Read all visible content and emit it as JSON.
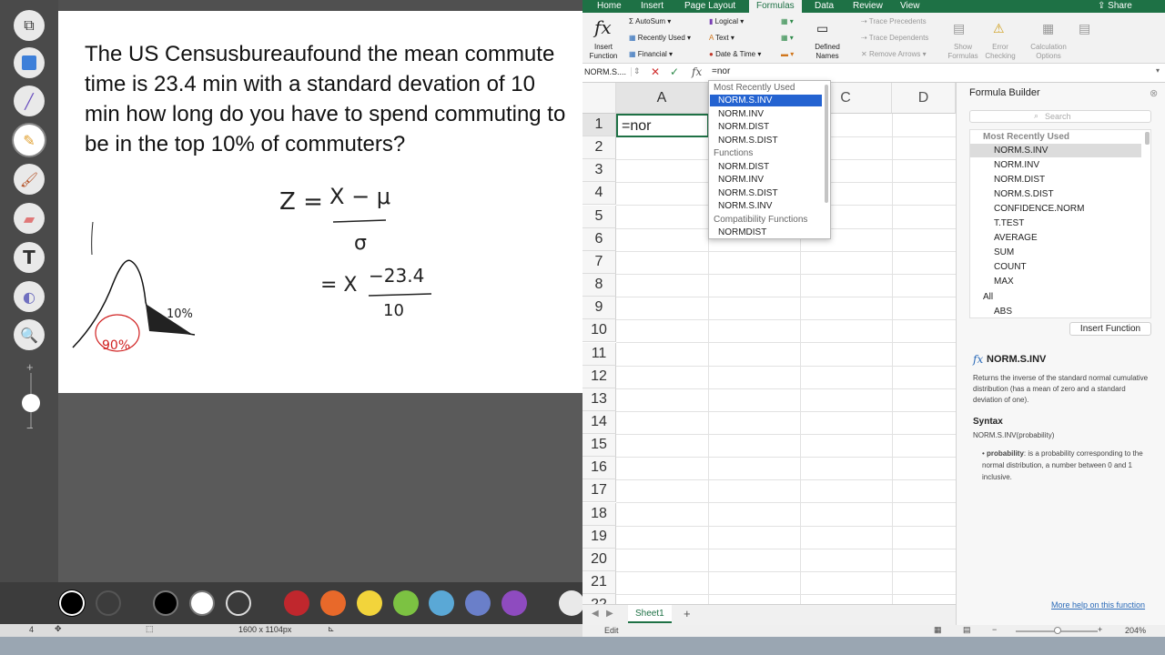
{
  "drawing_app": {
    "problem_text": "The US Censusbureaufound the mean commute time is 23.4 min with a standard devation of 10 min how long do you have to spend commuting to be in the top 10% of commuters?",
    "handwriting": {
      "z_formula_left": "Z = ",
      "z_numerator": "X − μ",
      "z_denominator": "σ",
      "eq_left": "= X ",
      "eq_numerator": "−23.4",
      "eq_denominator": "10",
      "ten_percent": "10%",
      "ninety_percent": "90%"
    },
    "tools": [
      "crop-icon",
      "rectangle-icon",
      "line-icon",
      "pencil-icon",
      "brush-icon",
      "eraser-icon",
      "text-icon",
      "fill-icon",
      "zoom-icon"
    ],
    "palette_colors": [
      "#000000",
      "#555555",
      "#000000",
      "#ffffff",
      "#3a3a3a",
      "#c0272d",
      "#e8692a",
      "#f2d43b",
      "#7cc242",
      "#5aa8d6",
      "#6a7fc9",
      "#8e4bbf"
    ],
    "status": {
      "page": "4",
      "dimensions": "1600 x 1104px"
    }
  },
  "excel": {
    "tabs": [
      "Home",
      "Insert",
      "Page Layout",
      "Formulas",
      "Data",
      "Review",
      "View"
    ],
    "active_tab": "Formulas",
    "share_label": "Share",
    "ribbon": {
      "insert_function": "Insert Function",
      "autosum": "AutoSum",
      "recently_used": "Recently Used",
      "financial": "Financial",
      "logical": "Logical",
      "text": "Text",
      "date_time": "Date & Time",
      "defined_names": "Defined Names",
      "trace_precedents": "Trace Precedents",
      "trace_dependents": "Trace Dependents",
      "remove_arrows": "Remove Arrows",
      "show_formulas": "Show Formulas",
      "error_checking": "Error Checking",
      "calculation_options": "Calculation Options"
    },
    "name_box": "NORM.S....",
    "fx": "fx",
    "formula_value": "=nor",
    "columns": [
      "A",
      "B",
      "C",
      "D"
    ],
    "rows": [
      "1",
      "2",
      "3",
      "4",
      "5",
      "6",
      "7",
      "8",
      "9",
      "10",
      "11",
      "12",
      "13",
      "14",
      "15",
      "16",
      "17",
      "18",
      "19",
      "20",
      "21",
      "22"
    ],
    "cell_a1": "=nor",
    "autocomplete": {
      "header_recent": "Most Recently Used",
      "recent": [
        "NORM.S.INV",
        "NORM.INV",
        "NORM.DIST",
        "NORM.S.DIST"
      ],
      "header_functions": "Functions",
      "functions": [
        "NORM.DIST",
        "NORM.INV",
        "NORM.S.DIST",
        "NORM.S.INV"
      ],
      "header_compat": "Compatibility Functions",
      "compat": [
        "NORMDIST"
      ]
    },
    "formula_builder": {
      "title": "Formula Builder",
      "search_placeholder": "Search",
      "group_recent": "Most Recently Used",
      "items": [
        "NORM.S.INV",
        "NORM.INV",
        "NORM.DIST",
        "NORM.S.DIST",
        "CONFIDENCE.NORM",
        "T.TEST",
        "AVERAGE",
        "SUM",
        "COUNT",
        "MAX"
      ],
      "group_all": "All",
      "all_items": [
        "ABS"
      ],
      "insert_button": "Insert Function",
      "fn_name": "NORM.S.INV",
      "fn_desc": "Returns the inverse of the standard normal cumulative distribution (has a mean of zero and a standard deviation of one).",
      "syntax_label": "Syntax",
      "syntax": "NORM.S.INV(probability)",
      "arg_name": "probability",
      "arg_desc": ": is a probability corresponding to the normal distribution, a number between 0 and 1 inclusive.",
      "more_help": "More help on this function"
    },
    "sheet_tab": "Sheet1",
    "status_mode": "Edit",
    "zoom": "204%"
  }
}
